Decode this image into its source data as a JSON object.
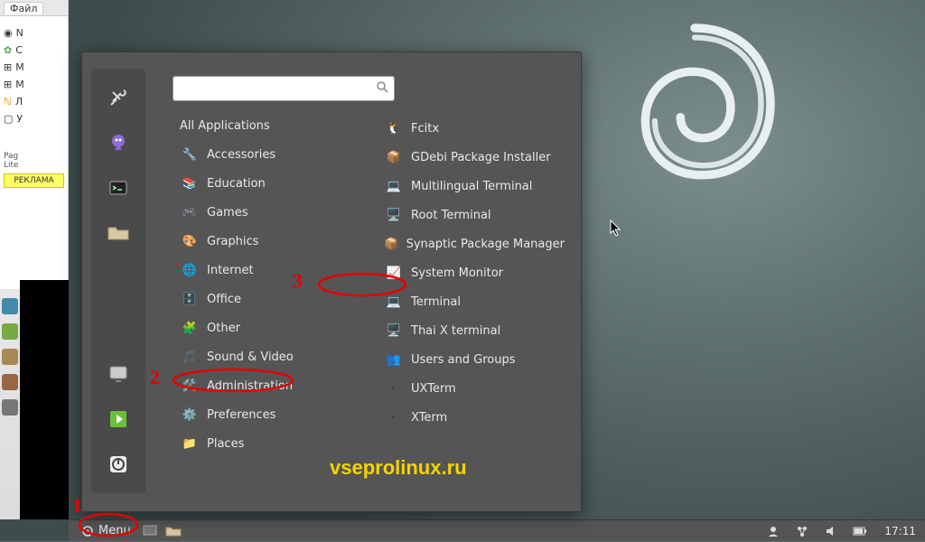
{
  "left_panel": {
    "tab": "Файл",
    "items": [
      "N",
      "C",
      "M",
      "M",
      "Л",
      "У"
    ],
    "sidebar_labels": [
      "Pag",
      "Lite"
    ],
    "ad_text": "РЕКЛАМА"
  },
  "menu": {
    "search_placeholder": "",
    "heading": "All Applications",
    "categories": [
      {
        "label": "Accessories",
        "icon": "🔧"
      },
      {
        "label": "Education",
        "icon": "📚"
      },
      {
        "label": "Games",
        "icon": "🎮"
      },
      {
        "label": "Graphics",
        "icon": "🎨"
      },
      {
        "label": "Internet",
        "icon": "🌐"
      },
      {
        "label": "Office",
        "icon": "🗄️"
      },
      {
        "label": "Other",
        "icon": "🧩"
      },
      {
        "label": "Sound & Video",
        "icon": "🎵"
      },
      {
        "label": "Administration",
        "icon": "🛠️",
        "highlight": true
      },
      {
        "label": "Preferences",
        "icon": "⚙️"
      },
      {
        "label": "Places",
        "icon": "📁"
      }
    ],
    "apps": [
      {
        "label": "Fcitx",
        "icon": "🐧"
      },
      {
        "label": "GDebi Package Installer",
        "icon": "📦"
      },
      {
        "label": "Multilingual Terminal",
        "icon": "💻"
      },
      {
        "label": "Root Terminal",
        "icon": "🖥️"
      },
      {
        "label": "Synaptic Package Manager",
        "icon": "📦"
      },
      {
        "label": "System Monitor",
        "icon": "📈"
      },
      {
        "label": "Terminal",
        "icon": "💻",
        "highlight": true
      },
      {
        "label": "Thai X terminal",
        "icon": "🖥️"
      },
      {
        "label": "Users and Groups",
        "icon": "👥"
      },
      {
        "label": "UXTerm",
        "icon": "▪️"
      },
      {
        "label": "XTerm",
        "icon": "▪️"
      }
    ]
  },
  "annotations": {
    "one": "1",
    "two": "2",
    "three": "3"
  },
  "watermark": "vseprolinux.ru",
  "taskbar": {
    "menu_label": "Menu",
    "clock": "17:11"
  }
}
